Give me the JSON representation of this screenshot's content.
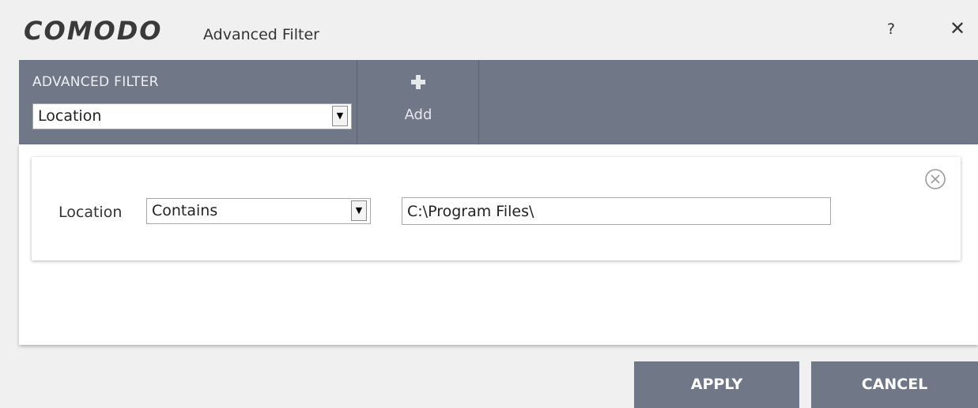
{
  "window": {
    "logo_text": "COMODO",
    "title": "Advanced Filter",
    "help_label": "?",
    "close_label": "✕"
  },
  "toolbar": {
    "filter_heading": "ADVANCED FILTER",
    "filter_selected": "Location",
    "add_label": "Add",
    "background_color": "#707787"
  },
  "rule": {
    "label": "Location",
    "operator": "Contains",
    "value": "C:\\Program Files\\"
  },
  "footer": {
    "apply_label": "APPLY",
    "cancel_label": "CANCEL"
  },
  "icons": [
    "plus-icon",
    "dropdown-arrow-icon",
    "remove-circle-icon",
    "close-icon",
    "help-icon"
  ]
}
